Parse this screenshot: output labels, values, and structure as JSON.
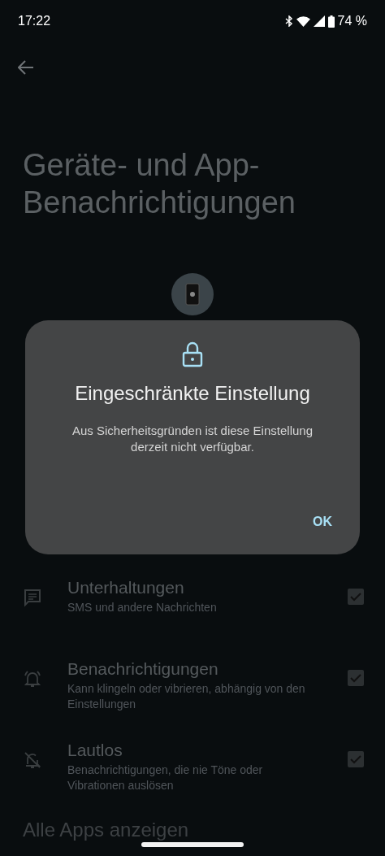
{
  "status_bar": {
    "time": "17:22",
    "battery": "74 %"
  },
  "page": {
    "title": "Geräte- und App-Benachrichtigungen"
  },
  "dialog": {
    "title": "Eingeschränkte Einstellung",
    "message": "Aus Sicherheitsgründen ist diese Einstellung derzeit nicht verfügbar.",
    "buttons": [
      "OK"
    ]
  },
  "options": [
    {
      "kind": "conversations",
      "title": "Unterhaltungen",
      "subtitle": "SMS und andere Nachrichten",
      "checked": true
    },
    {
      "kind": "alerting",
      "title": "Benachrichtigungen",
      "subtitle": "Kann klingeln oder vibrieren, abhängig von den Einstellungen",
      "checked": true
    },
    {
      "kind": "silent",
      "title": "Lautlos",
      "subtitle": "Benachrichtigungen, die nie Töne oder Vibrationen auslösen",
      "checked": true
    }
  ],
  "footer_link": "Alle Apps anzeigen"
}
